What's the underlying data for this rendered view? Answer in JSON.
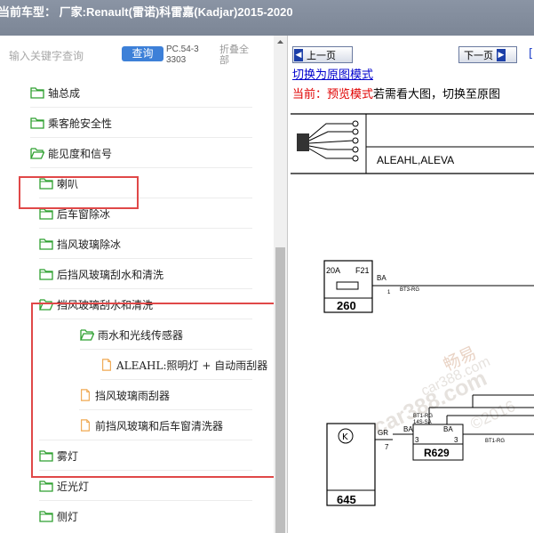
{
  "titlebar": {
    "text": "当前车型：  厂家:Renault(雷诺)科雷嘉(Kadjar)2015-2020"
  },
  "search": {
    "placeholder": "输入关键字查询",
    "button_label": "查询",
    "pc_number": "PC.54-33303",
    "collapse_label": "折叠全部"
  },
  "tree": {
    "items": [
      {
        "label": "轴总成",
        "type": "folder"
      },
      {
        "label": "乘客舱安全性",
        "type": "folder"
      },
      {
        "label": "能见度和信号",
        "type": "folder-open"
      },
      {
        "label": "喇叭",
        "type": "folder"
      },
      {
        "label": "后车窗除冰",
        "type": "folder"
      },
      {
        "label": "挡风玻璃除冰",
        "type": "folder"
      },
      {
        "label": "后挡风玻璃刮水和清洗",
        "type": "folder"
      },
      {
        "label": "挡风玻璃刮水和清洗",
        "type": "folder-open"
      },
      {
        "label": "雨水和光线传感器",
        "type": "folder-open"
      },
      {
        "label": "ALEAHL:照明灯 + 自动雨刮器",
        "type": "document"
      },
      {
        "label": "挡风玻璃雨刮器",
        "type": "document"
      },
      {
        "label": "前挡风玻璃和后车窗清洗器",
        "type": "document"
      },
      {
        "label": "雾灯",
        "type": "folder"
      },
      {
        "label": "近光灯",
        "type": "folder"
      },
      {
        "label": "侧灯",
        "type": "folder"
      }
    ]
  },
  "viewer": {
    "prev_label": "上一页",
    "next_label": "下一页",
    "next_link": "[",
    "switch_link": "切换为原图模式",
    "mode_prefix": "当前：",
    "mode_name": "预览模式",
    "mode_rest": "若需看大图，切换至原图"
  },
  "diagram": {
    "connector_label": "ALEAHL,ALEVA",
    "fuse_rating": "20A",
    "fuse_id": "F21",
    "fuse_wire": "BA",
    "fuse_pin": "1",
    "fuse_signal": "BT3-RG",
    "box_260": "260",
    "box_645": "645",
    "gr_wire": "GR",
    "gr_pin": "7",
    "ba_left": "BA",
    "ba_left_pin": "3",
    "ba_right": "BA",
    "ba_right_pin": "3",
    "r629": "R629",
    "bt1_rg_top": "BT1-RG",
    "s4s_sa": "14S-SA",
    "bt1_rg_mid": "BT1-RG",
    "bt1_rg_right": "BT1-RG",
    "watermark_1": "畅易",
    "watermark_2": "car388.com",
    "watermark_3": "car388.com",
    "watermark_4": "©2016"
  },
  "colors": {
    "highlight": "#e04848",
    "query_button": "#3d80d8",
    "folder": "#2fa030",
    "document": "#f0a850",
    "mode_red": "#e00000"
  }
}
